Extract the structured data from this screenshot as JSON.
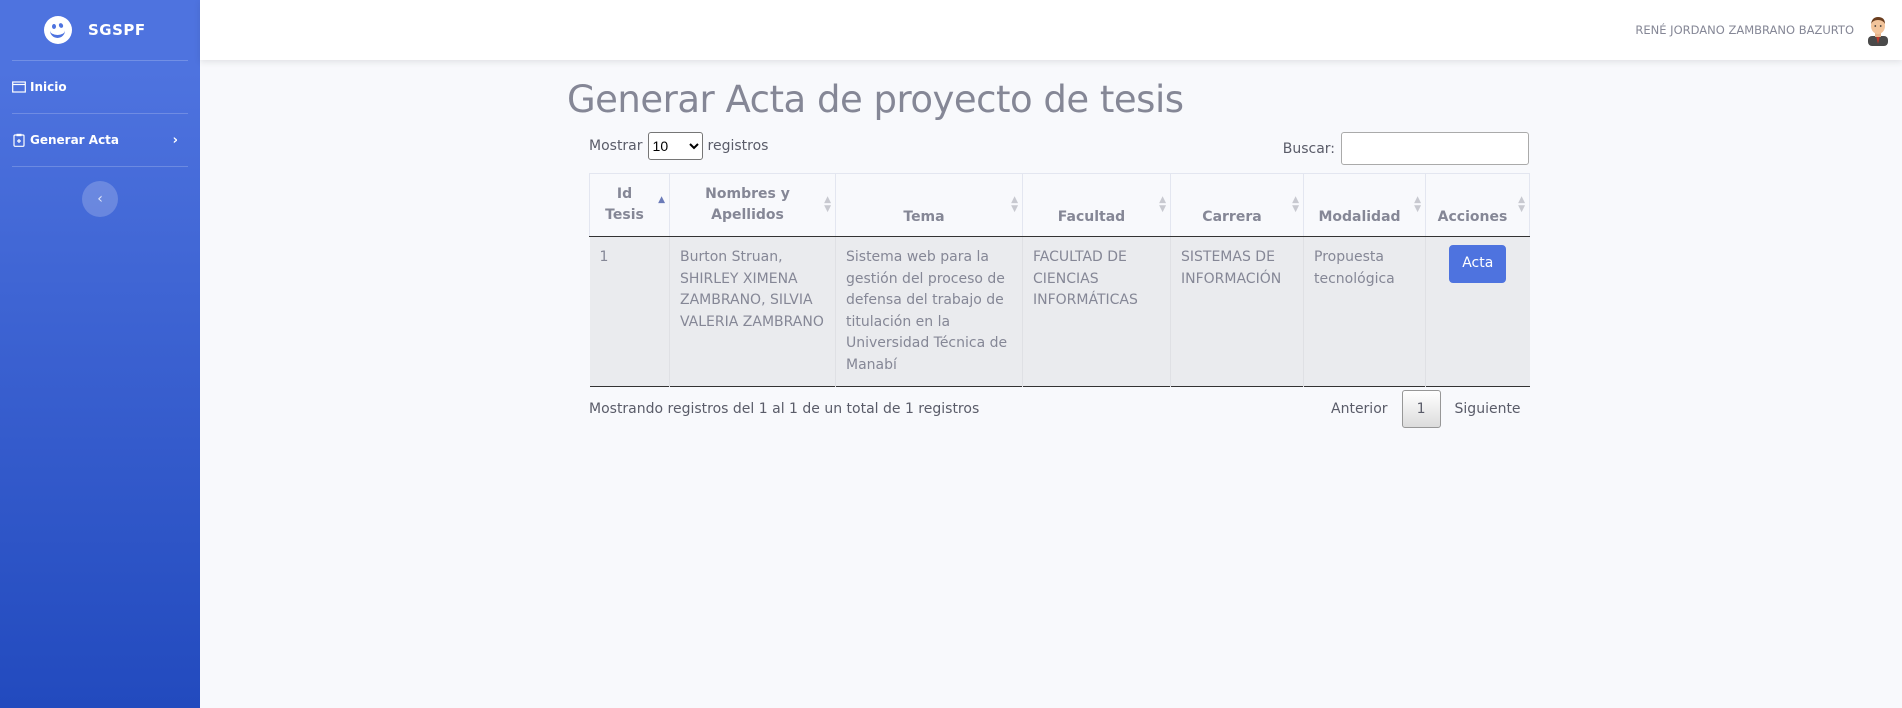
{
  "brand": {
    "name": "SGSPF"
  },
  "sidebar": {
    "items": [
      {
        "label": "Inicio",
        "icon": "window-icon"
      },
      {
        "label": "Generar Acta",
        "icon": "clipboard-icon"
      }
    ],
    "toggle_icon": "chevron-left-icon"
  },
  "topbar": {
    "user_name": "RENÉ JORDANO ZAMBRANO BAZURTO"
  },
  "page": {
    "title": "Generar Acta de proyecto de tesis"
  },
  "table_controls": {
    "show_label": "Mostrar",
    "page_size": "10",
    "records_label": "registros",
    "search_label": "Buscar:",
    "search_value": ""
  },
  "table": {
    "headers": [
      "Id Tesis",
      "Nombres y Apellidos",
      "Tema",
      "Facultad",
      "Carrera",
      "Modalidad",
      "Acciones"
    ],
    "sort_column": "Id Tesis",
    "sort_direction": "ascending",
    "rows": [
      {
        "id": "1",
        "nombres": "Burton Struan, SHIRLEY XIMENA ZAMBRANO, SILVIA VALERIA ZAMBRANO",
        "tema": "Sistema web para la gestión del proceso de defensa del trabajo de titulación en la Universidad Técnica de Manabí",
        "facultad": "FACULTAD DE CIENCIAS INFORMÁTICAS",
        "carrera": "SISTEMAS DE INFORMACIÓN",
        "modalidad": "Propuesta tecnológica",
        "action_label": "Acta"
      }
    ]
  },
  "footer": {
    "info": "Mostrando registros del 1 al 1 de un total de 1 registros",
    "prev_label": "Anterior",
    "current_page": "1",
    "next_label": "Siguiente"
  },
  "colors": {
    "primary": "#4e73df",
    "sidebar_bottom": "#224abe",
    "text_muted": "#858796",
    "row_bg": "#eaebee"
  }
}
